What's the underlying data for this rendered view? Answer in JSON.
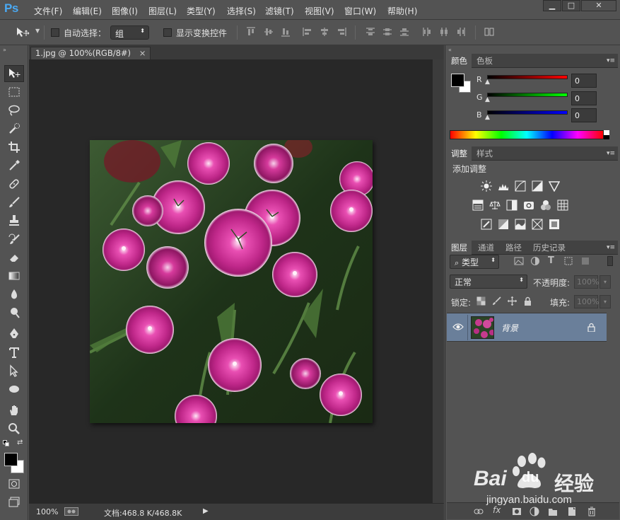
{
  "app": {
    "logo": "Ps"
  },
  "menu": [
    "文件(F)",
    "编辑(E)",
    "图像(I)",
    "图层(L)",
    "类型(Y)",
    "选择(S)",
    "滤镜(T)",
    "视图(V)",
    "窗口(W)",
    "帮助(H)"
  ],
  "window_controls": {
    "minimize": "▁",
    "maximize": "□",
    "close": "✕"
  },
  "options": {
    "auto_select_label": "自动选择：",
    "auto_select_value": "组",
    "transform_controls_label": "显示变换控件"
  },
  "document": {
    "tab_title": "1.jpg @ 100%(RGB/8#)",
    "tab_close": "×",
    "zoom": "100%",
    "doc_info": "文档:468.8 K/468.8K"
  },
  "color_panel": {
    "tabs": [
      "颜色",
      "色板"
    ],
    "r_label": "R",
    "g_label": "G",
    "b_label": "B",
    "r_value": "0",
    "g_value": "0",
    "b_value": "0",
    "foreground": "#000000",
    "background": "#ffffff"
  },
  "adjust_panel": {
    "tabs": [
      "调整",
      "样式"
    ],
    "title": "添加调整"
  },
  "layers_panel": {
    "tabs": [
      "图层",
      "通道",
      "路径",
      "历史记录"
    ],
    "filter_kind": "类型",
    "blend_mode": "正常",
    "opacity_label": "不透明度:",
    "opacity_value": "100%",
    "lock_label": "锁定:",
    "fill_label": "填充:",
    "fill_value": "100%",
    "layers": [
      {
        "name": "背景",
        "visible": true,
        "locked": true
      }
    ]
  },
  "watermark": {
    "brand": "Bai",
    "brand2": "du",
    "cn": "经验",
    "url": "jingyan.baidu.com"
  },
  "colors": {
    "accent_blue": "#4aa9f3",
    "layer_selected": "#6a7f9a",
    "flower_pink": "#c63a8e"
  }
}
